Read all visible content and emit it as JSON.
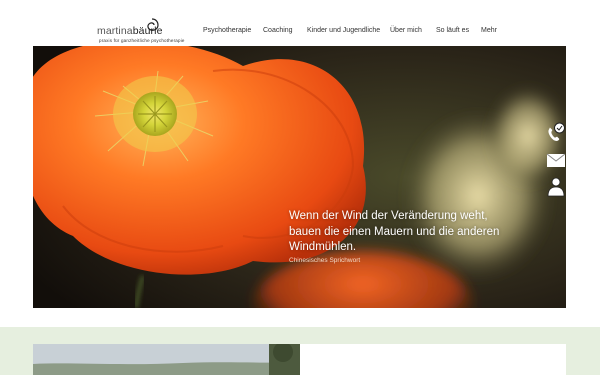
{
  "brand": {
    "name_light": "martina",
    "name_bold": "bäurle",
    "tagline": "praxis für ganzheitliche psychotherapie"
  },
  "nav": {
    "items": [
      {
        "label": "Psychotherapie"
      },
      {
        "label": "Coaching"
      },
      {
        "label": "Kinder und Jugendliche"
      },
      {
        "label": "Über mich"
      },
      {
        "label": "So läuft es"
      },
      {
        "label": "Mehr"
      }
    ]
  },
  "hero": {
    "quote_line1": "Wenn der Wind der Veränderung weht,",
    "quote_line2": "bauen die einen Mauern und die anderen",
    "quote_line3": "Windmühlen.",
    "source": "Chinesisches Sprichwort"
  },
  "side_icons": [
    "phone-icon",
    "mail-icon",
    "person-icon"
  ],
  "colors": {
    "poppy": "#f2541b",
    "poppy_center": "#cdd23a",
    "section_band": "#e6efdf"
  }
}
